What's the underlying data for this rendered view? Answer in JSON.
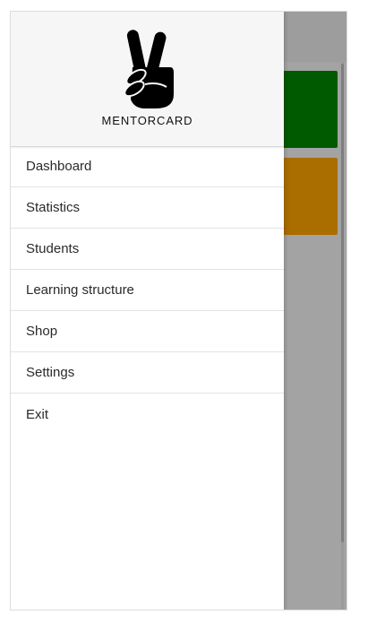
{
  "brand": {
    "name": "MENTORCARD",
    "logo_icon": "peace-hand-icon"
  },
  "menu": {
    "items": [
      {
        "label": "Dashboard"
      },
      {
        "label": "Statistics"
      },
      {
        "label": "Students"
      },
      {
        "label": "Learning structure"
      },
      {
        "label": "Shop"
      },
      {
        "label": "Settings"
      },
      {
        "label": "Exit"
      }
    ]
  },
  "colors": {
    "overlay": "#a3a3a3",
    "card_green": "#005a00",
    "card_orange": "#aa6d00",
    "drawer_bg": "#ffffff",
    "drawer_header_bg": "#f6f6f6"
  }
}
